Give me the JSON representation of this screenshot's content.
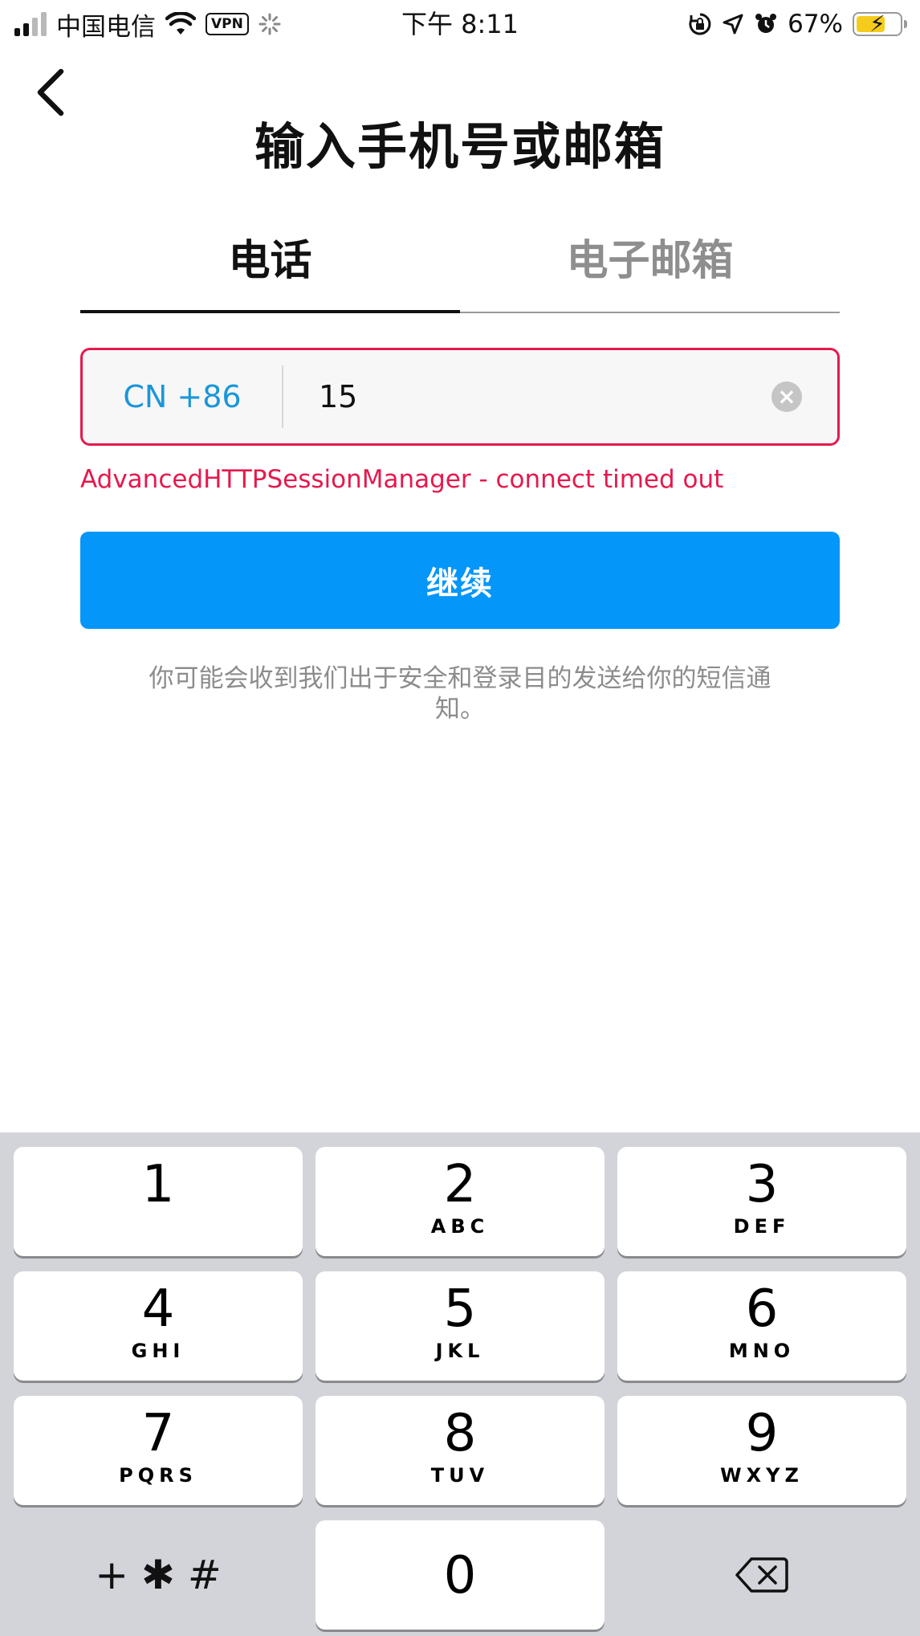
{
  "status_bar": {
    "carrier": "中国电信",
    "vpn": "VPN",
    "time": "下午 8:11",
    "battery_percent": "67%",
    "battery_level": 0.67
  },
  "header": {
    "title": "输入手机号或邮箱"
  },
  "tabs": [
    {
      "label": "电话",
      "active": true
    },
    {
      "label": "电子邮箱",
      "active": false
    }
  ],
  "phone_field": {
    "country_code": "CN +86",
    "value": "15"
  },
  "error": "AdvancedHTTPSessionManager - connect timed out",
  "continue_label": "继续",
  "notice": "你可能会收到我们出于安全和登录目的发送给你的短信通知。",
  "keypad": {
    "keys": [
      {
        "digit": "1",
        "letters": ""
      },
      {
        "digit": "2",
        "letters": "ABC"
      },
      {
        "digit": "3",
        "letters": "DEF"
      },
      {
        "digit": "4",
        "letters": "GHI"
      },
      {
        "digit": "5",
        "letters": "JKL"
      },
      {
        "digit": "6",
        "letters": "MNO"
      },
      {
        "digit": "7",
        "letters": "PQRS"
      },
      {
        "digit": "8",
        "letters": "TUV"
      },
      {
        "digit": "9",
        "letters": "WXYZ"
      }
    ],
    "symbols": "+ ✱ #",
    "zero": "0"
  },
  "colors": {
    "accent_blue": "#0596fa",
    "error_red": "#e5194d",
    "country_code_blue": "#1a96d7",
    "battery_yellow": "#f6cc1c"
  }
}
